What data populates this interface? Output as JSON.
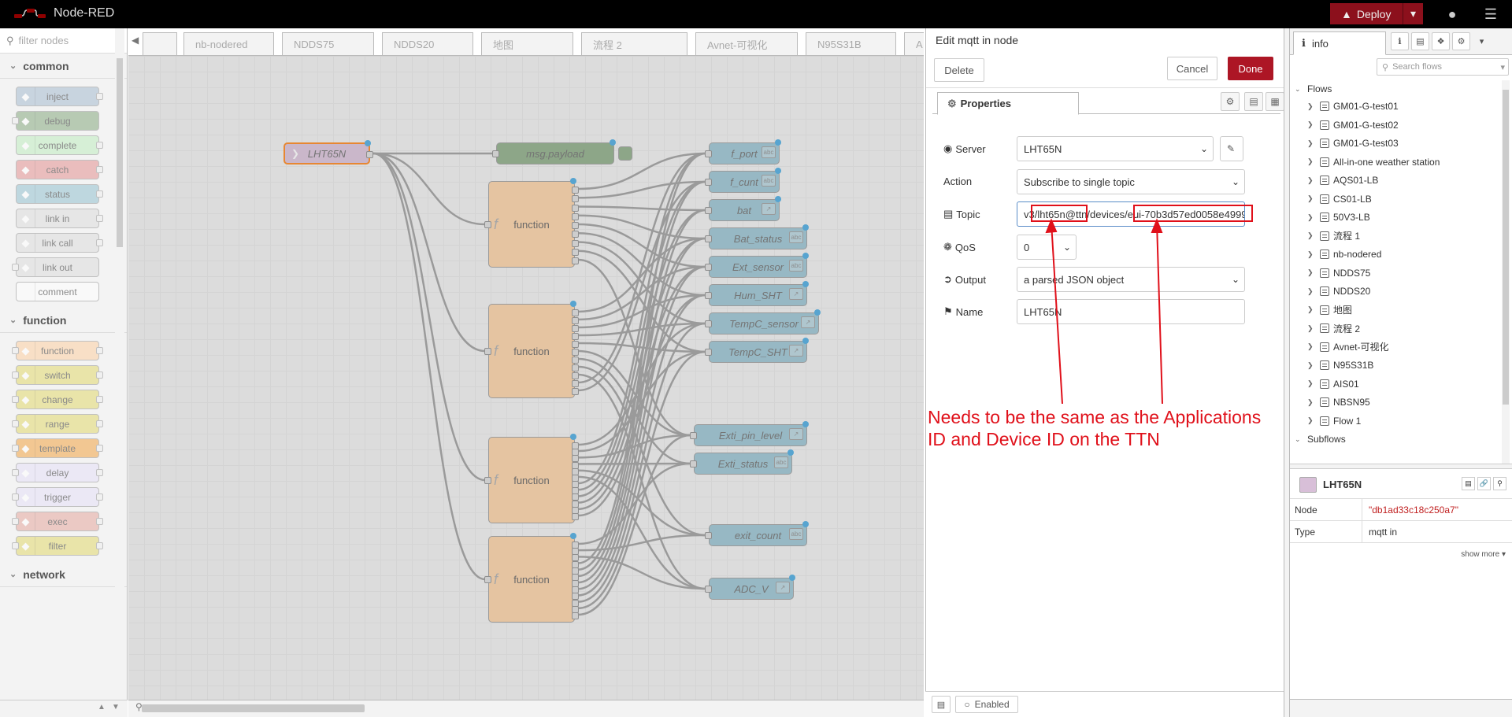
{
  "header": {
    "title": "Node-RED",
    "deploy_label": "Deploy"
  },
  "palette": {
    "filter_placeholder": "filter nodes",
    "categories": [
      {
        "label": "common",
        "nodes": [
          {
            "label": "inject",
            "color": "#a6bbcf",
            "icon": "inject-icon"
          },
          {
            "label": "debug",
            "color": "#87a980",
            "icon": "debug-icon"
          },
          {
            "label": "complete",
            "color": "#c0edc0",
            "icon": "complete-icon"
          },
          {
            "label": "catch",
            "color": "#e49191",
            "icon": "catch-icon"
          },
          {
            "label": "status",
            "color": "#94c1d0",
            "icon": "status-icon"
          },
          {
            "label": "link in",
            "color": "#dddddd",
            "icon": "link-in-icon"
          },
          {
            "label": "link call",
            "color": "#dddddd",
            "icon": "link-call-icon"
          },
          {
            "label": "link out",
            "color": "#dddddd",
            "icon": "link-out-icon"
          },
          {
            "label": "comment",
            "color": "#ffffff",
            "icon": "comment-icon"
          }
        ]
      },
      {
        "label": "function",
        "nodes": [
          {
            "label": "function",
            "color": "#fdd0a2",
            "icon": "function-icon"
          },
          {
            "label": "switch",
            "color": "#e2d96e",
            "icon": "switch-icon"
          },
          {
            "label": "change",
            "color": "#e2d96e",
            "icon": "change-icon"
          },
          {
            "label": "range",
            "color": "#e2d96e",
            "icon": "range-icon"
          },
          {
            "label": "template",
            "color": "#f2a444",
            "icon": "template-icon"
          },
          {
            "label": "delay",
            "color": "#e6e0f8",
            "icon": "delay-icon"
          },
          {
            "label": "trigger",
            "color": "#e6e0f8",
            "icon": "trigger-icon"
          },
          {
            "label": "exec",
            "color": "#e5a79f",
            "icon": "exec-icon"
          },
          {
            "label": "filter",
            "color": "#e2d96e",
            "icon": "filter-icon"
          }
        ]
      },
      {
        "label": "network",
        "nodes": []
      }
    ]
  },
  "workspace": {
    "tabs": [
      "",
      "nb-nodered",
      "NDDS75",
      "NDDS20",
      "地图",
      "流程 2",
      "Avnet-可视化",
      "N95S31B",
      "A"
    ],
    "nodes": {
      "mqtt": "LHT65N",
      "debug": "msg.payload",
      "fn1": "function",
      "fn2": "function",
      "fn3": "function",
      "fn4": "function",
      "out1": "f_port",
      "out2": "f_cunt",
      "out3": "bat",
      "out4": "Bat_status",
      "out5": "Ext_sensor",
      "out6": "Hum_SHT",
      "out7": "TempC_sensor",
      "out8": "TempC_SHT",
      "out9": "Exti_pin_level",
      "out10": "Exti_status",
      "out11": "exit_count",
      "out12": "ADC_V"
    }
  },
  "editor": {
    "title": "Edit mqtt in node",
    "delete_label": "Delete",
    "cancel_label": "Cancel",
    "done_label": "Done",
    "tab_label": "Properties",
    "fields": {
      "server_label": "Server",
      "server_value": "LHT65N",
      "action_label": "Action",
      "action_value": "Subscribe to single topic",
      "topic_label": "Topic",
      "topic_value": "v3/lht65n@ttn/devices/eui-70b3d57ed0058e4999",
      "qos_label": "QoS",
      "qos_value": "0",
      "output_label": "Output",
      "output_value": "a parsed JSON object",
      "name_label": "Name",
      "name_value": "LHT65N"
    },
    "annotation": "Needs to be the same as the Applications ID and Device ID on the TTN",
    "enabled_label": "Enabled"
  },
  "sidebar": {
    "tab_label": "info",
    "search_placeholder": "Search flows",
    "flows_label": "Flows",
    "flows": [
      "GM01-G-test01",
      "GM01-G-test02",
      "GM01-G-test03",
      "All-in-one weather station",
      "AQS01-LB",
      "CS01-LB",
      "50V3-LB",
      "流程 1",
      "nb-nodered",
      "NDDS75",
      "NDDS20",
      "地图",
      "流程 2",
      "Avnet-可视化",
      "N95S31B",
      "AIS01",
      "NBSN95",
      "Flow 1"
    ],
    "subflows_label": "Subflows",
    "info": {
      "node_title": "LHT65N",
      "node_key": "Node",
      "node_value": "\"db1ad33c18c250a7\"",
      "type_key": "Type",
      "type_value": "mqtt in",
      "show_more": "show more"
    }
  },
  "colors": {
    "deploy": "#8c101c",
    "done": "#ad1625",
    "annotation": "#e0101a",
    "selection": "#ff7f0e",
    "port_dot": "#3fa6e0"
  }
}
